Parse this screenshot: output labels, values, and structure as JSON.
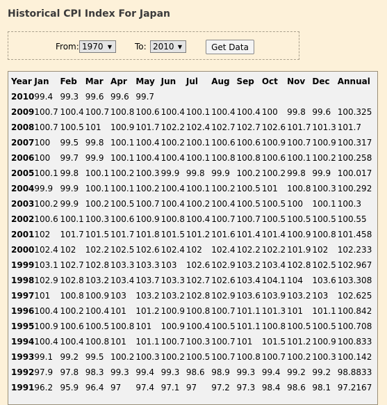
{
  "title": "Historical CPI Index For Japan",
  "form": {
    "from_label": "From:",
    "from_value": "1970",
    "to_label": "To:",
    "to_value": "2010",
    "button_label": "Get Data"
  },
  "table": {
    "headers": [
      "Year",
      "Jan",
      "Feb",
      "Mar",
      "Apr",
      "May",
      "Jun",
      "Jul",
      "Aug",
      "Sep",
      "Oct",
      "Nov",
      "Dec",
      "Annual"
    ],
    "rows": [
      [
        "2010",
        "99.4",
        "99.3",
        "99.6",
        "99.6",
        "99.7",
        "",
        "",
        "",
        "",
        "",
        "",
        "",
        ""
      ],
      [
        "2009",
        "100.7",
        "100.4",
        "100.7",
        "100.8",
        "100.6",
        "100.4",
        "100.1",
        "100.4",
        "100.4",
        "100",
        "99.8",
        "99.6",
        "100.325"
      ],
      [
        "2008",
        "100.7",
        "100.5",
        "101",
        "100.9",
        "101.7",
        "102.2",
        "102.4",
        "102.7",
        "102.7",
        "102.6",
        "101.7",
        "101.3",
        "101.7"
      ],
      [
        "2007",
        "100",
        "99.5",
        "99.8",
        "100.1",
        "100.4",
        "100.2",
        "100.1",
        "100.6",
        "100.6",
        "100.9",
        "100.7",
        "100.9",
        "100.317"
      ],
      [
        "2006",
        "100",
        "99.7",
        "99.9",
        "100.1",
        "100.4",
        "100.4",
        "100.1",
        "100.8",
        "100.8",
        "100.6",
        "100.1",
        "100.2",
        "100.258"
      ],
      [
        "2005",
        "100.1",
        "99.8",
        "100.1",
        "100.2",
        "100.3",
        "99.9",
        "99.8",
        "99.9",
        "100.2",
        "100.2",
        "99.8",
        "99.9",
        "100.017"
      ],
      [
        "2004",
        "99.9",
        "99.9",
        "100.1",
        "100.1",
        "100.2",
        "100.4",
        "100.1",
        "100.2",
        "100.5",
        "101",
        "100.8",
        "100.3",
        "100.292"
      ],
      [
        "2003",
        "100.2",
        "99.9",
        "100.2",
        "100.5",
        "100.7",
        "100.4",
        "100.2",
        "100.4",
        "100.5",
        "100.5",
        "100",
        "100.1",
        "100.3"
      ],
      [
        "2002",
        "100.6",
        "100.1",
        "100.3",
        "100.6",
        "100.9",
        "100.8",
        "100.4",
        "100.7",
        "100.7",
        "100.5",
        "100.5",
        "100.5",
        "100.55"
      ],
      [
        "2001",
        "102",
        "101.7",
        "101.5",
        "101.7",
        "101.8",
        "101.5",
        "101.2",
        "101.6",
        "101.4",
        "101.4",
        "100.9",
        "100.8",
        "101.458"
      ],
      [
        "2000",
        "102.4",
        "102",
        "102.2",
        "102.5",
        "102.6",
        "102.4",
        "102",
        "102.4",
        "102.2",
        "102.2",
        "101.9",
        "102",
        "102.233"
      ],
      [
        "1999",
        "103.1",
        "102.7",
        "102.8",
        "103.3",
        "103.3",
        "103",
        "102.6",
        "102.9",
        "103.2",
        "103.4",
        "102.8",
        "102.5",
        "102.967"
      ],
      [
        "1998",
        "102.9",
        "102.8",
        "103.2",
        "103.4",
        "103.7",
        "103.3",
        "102.7",
        "102.6",
        "103.4",
        "104.1",
        "104",
        "103.6",
        "103.308"
      ],
      [
        "1997",
        "101",
        "100.8",
        "100.9",
        "103",
        "103.2",
        "103.2",
        "102.8",
        "102.9",
        "103.6",
        "103.9",
        "103.2",
        "103",
        "102.625"
      ],
      [
        "1996",
        "100.4",
        "100.2",
        "100.4",
        "101",
        "101.2",
        "100.9",
        "100.8",
        "100.7",
        "101.1",
        "101.3",
        "101",
        "101.1",
        "100.842"
      ],
      [
        "1995",
        "100.9",
        "100.6",
        "100.5",
        "100.8",
        "101",
        "100.9",
        "100.4",
        "100.5",
        "101.1",
        "100.8",
        "100.5",
        "100.5",
        "100.708"
      ],
      [
        "1994",
        "100.4",
        "100.4",
        "100.8",
        "101",
        "101.1",
        "100.7",
        "100.3",
        "100.7",
        "101",
        "101.5",
        "101.2",
        "100.9",
        "100.833"
      ],
      [
        "1993",
        "99.1",
        "99.2",
        "99.5",
        "100.2",
        "100.3",
        "100.2",
        "100.5",
        "100.7",
        "100.8",
        "100.7",
        "100.2",
        "100.3",
        "100.142"
      ],
      [
        "1992",
        "97.9",
        "97.8",
        "98.3",
        "99.3",
        "99.4",
        "99.3",
        "98.6",
        "98.9",
        "99.3",
        "99.4",
        "99.2",
        "99.2",
        "98.8833"
      ],
      [
        "1991",
        "96.2",
        "95.9",
        "96.4",
        "97",
        "97.4",
        "97.1",
        "97",
        "97.2",
        "97.3",
        "98.4",
        "98.6",
        "98.1",
        "97.2167"
      ]
    ]
  }
}
